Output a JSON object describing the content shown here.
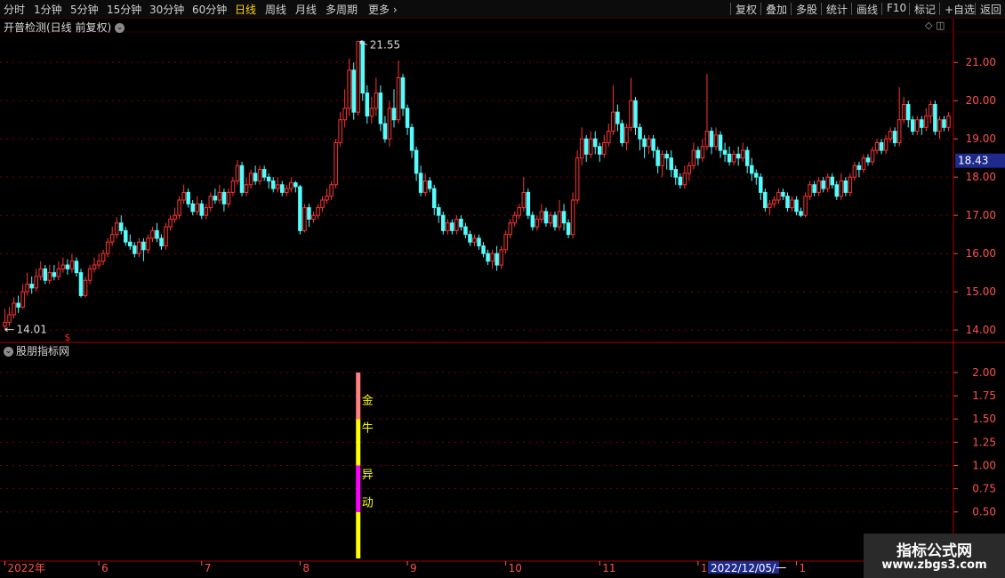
{
  "toolbar": {
    "periods": [
      "分时",
      "1分钟",
      "5分钟",
      "15分钟",
      "30分钟",
      "60分钟",
      "日线",
      "周线",
      "月线",
      "多周期",
      "更多"
    ],
    "active_period": "日线",
    "more_arrow": "›",
    "right": [
      "复权",
      "叠加",
      "多股",
      "统计",
      "画线",
      "F10",
      "标记",
      "+自选",
      "返回"
    ]
  },
  "main_panel": {
    "title": "开普检测(日线 前复权)",
    "high_label": "21.55",
    "low_label": "14.01",
    "current_price": "18.43",
    "marker_symbol": "$"
  },
  "indicator_panel": {
    "title": "股朋指标网",
    "signal_labels": [
      "金",
      "牛",
      "异",
      "动"
    ]
  },
  "time_axis": {
    "labels": [
      "2022年",
      "6",
      "7",
      "8",
      "9",
      "10",
      "11",
      "12",
      "1"
    ],
    "cursor_label": "2022/12/05/一"
  },
  "watermark": {
    "line1": "指标公式网",
    "line2": "www.zbgs3.com"
  },
  "colors": {
    "up": "#ff3333",
    "down": "#54fcfc",
    "grid": "#7a0000",
    "axis_text": "#ff5050",
    "signal_gold": "#ff8080",
    "signal_yellow": "#ffff00",
    "signal_magenta": "#ff00ff"
  },
  "chart_data": [
    {
      "type": "candlestick",
      "ylim": [
        13.7,
        21.75
      ],
      "yticks": [
        14.0,
        15.0,
        16.0,
        17.0,
        18.0,
        19.0,
        20.0,
        21.0
      ],
      "candles": [
        [
          14.1,
          14.2,
          14.55,
          14.01
        ],
        [
          14.2,
          14.4,
          14.6,
          14.1
        ],
        [
          14.4,
          14.7,
          14.85,
          14.3
        ],
        [
          14.7,
          14.6,
          14.9,
          14.45
        ],
        [
          14.6,
          15.0,
          15.2,
          14.55
        ],
        [
          15.0,
          15.2,
          15.5,
          14.9
        ],
        [
          15.2,
          15.1,
          15.4,
          14.95
        ],
        [
          15.1,
          15.4,
          15.6,
          15.0
        ],
        [
          15.4,
          15.6,
          15.8,
          15.3
        ],
        [
          15.6,
          15.3,
          15.7,
          15.2
        ],
        [
          15.3,
          15.5,
          15.7,
          15.2
        ],
        [
          15.5,
          15.4,
          15.7,
          15.3
        ],
        [
          15.4,
          15.6,
          15.8,
          15.3
        ],
        [
          15.6,
          15.7,
          15.9,
          15.5
        ],
        [
          15.7,
          15.6,
          15.85,
          15.45
        ],
        [
          15.6,
          15.8,
          16.0,
          15.5
        ],
        [
          15.8,
          15.5,
          15.9,
          15.4
        ],
        [
          15.5,
          14.9,
          15.6,
          14.85
        ],
        [
          14.9,
          15.3,
          15.4,
          14.85
        ],
        [
          15.3,
          15.6,
          15.7,
          15.2
        ],
        [
          15.6,
          15.7,
          15.9,
          15.5
        ],
        [
          15.7,
          15.8,
          16.0,
          15.6
        ],
        [
          15.8,
          16.0,
          16.1,
          15.7
        ],
        [
          16.0,
          16.3,
          16.4,
          15.9
        ],
        [
          16.3,
          16.5,
          16.7,
          16.2
        ],
        [
          16.5,
          16.8,
          16.95,
          16.4
        ],
        [
          16.8,
          16.6,
          17.0,
          16.5
        ],
        [
          16.6,
          16.3,
          16.7,
          16.2
        ],
        [
          16.3,
          16.2,
          16.5,
          16.1
        ],
        [
          16.2,
          16.0,
          16.3,
          15.9
        ],
        [
          16.0,
          16.3,
          16.4,
          15.9
        ],
        [
          16.3,
          16.1,
          16.4,
          15.8
        ],
        [
          16.1,
          16.4,
          16.5,
          16.0
        ],
        [
          16.4,
          16.6,
          16.7,
          16.3
        ],
        [
          16.6,
          16.4,
          16.8,
          16.3
        ],
        [
          16.4,
          16.2,
          16.5,
          16.1
        ],
        [
          16.2,
          16.7,
          16.8,
          16.1
        ],
        [
          16.7,
          16.9,
          17.0,
          16.6
        ],
        [
          16.9,
          17.0,
          17.2,
          16.8
        ],
        [
          17.0,
          17.4,
          17.5,
          16.9
        ],
        [
          17.4,
          17.6,
          17.8,
          17.3
        ],
        [
          17.6,
          17.3,
          17.7,
          17.2
        ],
        [
          17.3,
          17.1,
          17.4,
          17.0
        ],
        [
          17.1,
          17.3,
          17.5,
          17.0
        ],
        [
          17.3,
          17.0,
          17.4,
          16.9
        ],
        [
          17.0,
          17.2,
          17.3,
          16.9
        ],
        [
          17.2,
          17.5,
          17.6,
          17.1
        ],
        [
          17.5,
          17.4,
          17.7,
          17.3
        ],
        [
          17.4,
          17.6,
          17.8,
          17.3
        ],
        [
          17.6,
          17.3,
          17.7,
          17.1
        ],
        [
          17.3,
          17.6,
          17.7,
          17.2
        ],
        [
          17.6,
          17.9,
          18.0,
          17.5
        ],
        [
          17.9,
          18.3,
          18.45,
          17.8
        ],
        [
          18.3,
          17.6,
          18.4,
          17.5
        ],
        [
          17.6,
          17.8,
          18.0,
          17.5
        ],
        [
          17.8,
          18.1,
          18.2,
          17.7
        ],
        [
          18.1,
          17.9,
          18.3,
          17.8
        ],
        [
          17.9,
          18.2,
          18.3,
          17.8
        ],
        [
          18.2,
          18.0,
          18.3,
          17.9
        ],
        [
          18.0,
          17.9,
          18.1,
          17.7
        ],
        [
          17.9,
          17.7,
          18.0,
          17.6
        ],
        [
          17.7,
          17.8,
          18.0,
          17.6
        ],
        [
          17.8,
          17.6,
          17.9,
          17.5
        ],
        [
          17.6,
          17.7,
          17.8,
          17.5
        ],
        [
          17.7,
          17.85,
          18.0,
          17.6
        ],
        [
          17.85,
          17.75,
          17.9,
          17.6
        ],
        [
          17.75,
          16.6,
          17.8,
          16.5
        ],
        [
          16.6,
          17.2,
          17.3,
          16.55
        ],
        [
          17.2,
          16.9,
          17.3,
          16.7
        ],
        [
          16.9,
          17.0,
          17.1,
          16.8
        ],
        [
          17.0,
          17.2,
          17.3,
          16.9
        ],
        [
          17.2,
          17.4,
          17.5,
          17.1
        ],
        [
          17.4,
          17.5,
          17.7,
          17.3
        ],
        [
          17.5,
          17.8,
          17.9,
          17.4
        ],
        [
          17.8,
          18.9,
          19.0,
          17.7
        ],
        [
          18.9,
          19.5,
          19.7,
          18.8
        ],
        [
          19.5,
          19.8,
          20.3,
          19.3
        ],
        [
          19.8,
          20.8,
          21.1,
          19.6
        ],
        [
          20.8,
          19.7,
          21.0,
          19.5
        ],
        [
          19.7,
          21.55,
          21.55,
          19.6
        ],
        [
          21.55,
          20.2,
          21.4,
          20.0
        ],
        [
          20.2,
          19.6,
          20.4,
          19.4
        ],
        [
          19.6,
          19.8,
          20.1,
          19.4
        ],
        [
          19.8,
          20.2,
          20.6,
          19.6
        ],
        [
          20.2,
          19.4,
          20.4,
          19.2
        ],
        [
          19.4,
          19.0,
          19.6,
          18.9
        ],
        [
          19.0,
          19.8,
          20.0,
          18.8
        ],
        [
          19.8,
          19.5,
          20.3,
          19.3
        ],
        [
          19.5,
          20.6,
          21.05,
          19.4
        ],
        [
          20.6,
          19.8,
          20.7,
          19.6
        ],
        [
          19.8,
          19.3,
          19.9,
          19.1
        ],
        [
          19.3,
          18.7,
          19.4,
          18.5
        ],
        [
          18.7,
          18.1,
          18.8,
          17.9
        ],
        [
          18.1,
          17.6,
          18.3,
          17.5
        ],
        [
          17.6,
          17.9,
          18.1,
          17.5
        ],
        [
          17.9,
          17.7,
          18.0,
          17.6
        ],
        [
          17.7,
          17.2,
          17.8,
          17.0
        ],
        [
          17.2,
          17.0,
          17.3,
          16.8
        ],
        [
          17.0,
          16.6,
          17.1,
          16.5
        ],
        [
          16.6,
          16.8,
          16.9,
          16.5
        ],
        [
          16.8,
          16.6,
          16.9,
          16.5
        ],
        [
          16.6,
          16.9,
          17.0,
          16.5
        ],
        [
          16.9,
          16.7,
          17.0,
          16.6
        ],
        [
          16.7,
          16.5,
          16.8,
          16.4
        ],
        [
          16.5,
          16.3,
          16.6,
          16.2
        ],
        [
          16.3,
          16.4,
          16.5,
          16.2
        ],
        [
          16.4,
          16.2,
          16.5,
          16.1
        ],
        [
          16.2,
          16.0,
          16.3,
          15.9
        ],
        [
          16.0,
          15.8,
          16.1,
          15.7
        ],
        [
          15.8,
          16.0,
          16.1,
          15.6
        ],
        [
          16.0,
          15.7,
          16.2,
          15.55
        ],
        [
          15.7,
          16.1,
          16.2,
          15.6
        ],
        [
          16.1,
          16.5,
          16.6,
          16.0
        ],
        [
          16.5,
          16.8,
          16.9,
          16.4
        ],
        [
          16.8,
          17.0,
          17.1,
          16.7
        ],
        [
          17.0,
          17.2,
          17.3,
          16.9
        ],
        [
          17.2,
          17.6,
          18.0,
          17.1
        ],
        [
          17.6,
          17.0,
          17.7,
          16.9
        ],
        [
          17.0,
          16.7,
          17.1,
          16.6
        ],
        [
          16.7,
          16.9,
          17.0,
          16.6
        ],
        [
          16.9,
          17.1,
          17.3,
          16.8
        ],
        [
          17.1,
          16.8,
          17.2,
          16.7
        ],
        [
          16.8,
          17.0,
          17.1,
          16.7
        ],
        [
          17.0,
          16.7,
          17.1,
          16.6
        ],
        [
          16.7,
          17.1,
          17.4,
          16.6
        ],
        [
          17.1,
          16.8,
          17.3,
          16.6
        ],
        [
          16.8,
          16.5,
          16.9,
          16.4
        ],
        [
          16.5,
          17.4,
          17.6,
          16.4
        ],
        [
          17.4,
          18.5,
          18.7,
          17.3
        ],
        [
          18.5,
          19.0,
          19.3,
          18.3
        ],
        [
          19.0,
          18.6,
          19.1,
          18.4
        ],
        [
          18.6,
          19.0,
          19.2,
          18.5
        ],
        [
          19.0,
          18.8,
          19.2,
          18.6
        ],
        [
          18.8,
          18.6,
          18.9,
          18.4
        ],
        [
          18.6,
          18.9,
          19.1,
          18.5
        ],
        [
          18.9,
          19.2,
          19.4,
          18.8
        ],
        [
          19.2,
          19.7,
          20.4,
          19.1
        ],
        [
          19.7,
          19.4,
          19.9,
          19.2
        ],
        [
          19.4,
          18.9,
          19.5,
          18.8
        ],
        [
          18.9,
          19.3,
          19.4,
          18.7
        ],
        [
          19.3,
          20.0,
          20.6,
          19.2
        ],
        [
          20.0,
          19.3,
          20.1,
          19.1
        ],
        [
          19.3,
          19.0,
          19.4,
          18.7
        ],
        [
          19.0,
          18.8,
          19.1,
          18.5
        ],
        [
          18.8,
          19.0,
          19.1,
          18.6
        ],
        [
          19.0,
          18.7,
          19.1,
          18.5
        ],
        [
          18.7,
          18.3,
          18.8,
          18.1
        ],
        [
          18.3,
          18.6,
          18.7,
          18.0
        ],
        [
          18.6,
          18.5,
          18.7,
          18.2
        ],
        [
          18.5,
          18.2,
          18.7,
          18.0
        ],
        [
          18.2,
          18.0,
          18.3,
          17.8
        ],
        [
          18.0,
          17.8,
          18.1,
          17.7
        ],
        [
          17.8,
          18.1,
          18.3,
          17.7
        ],
        [
          18.1,
          18.3,
          18.4,
          17.9
        ],
        [
          18.3,
          18.7,
          18.9,
          18.2
        ],
        [
          18.7,
          18.5,
          18.8,
          18.3
        ],
        [
          18.5,
          18.8,
          19.0,
          18.4
        ],
        [
          18.8,
          19.2,
          20.7,
          18.7
        ],
        [
          19.2,
          18.8,
          19.3,
          18.6
        ],
        [
          18.8,
          19.1,
          19.3,
          18.7
        ],
        [
          19.1,
          18.7,
          19.2,
          18.5
        ],
        [
          18.7,
          18.6,
          18.9,
          18.4
        ],
        [
          18.6,
          18.4,
          18.8,
          18.3
        ],
        [
          18.4,
          18.6,
          18.7,
          18.3
        ],
        [
          18.6,
          18.5,
          18.8,
          18.3
        ],
        [
          18.5,
          18.7,
          18.9,
          18.4
        ],
        [
          18.7,
          18.3,
          18.8,
          18.1
        ],
        [
          18.3,
          18.1,
          18.5,
          17.9
        ],
        [
          18.1,
          18.0,
          18.2,
          17.8
        ],
        [
          18.0,
          17.6,
          18.1,
          17.4
        ],
        [
          17.6,
          17.2,
          17.7,
          17.1
        ],
        [
          17.2,
          17.3,
          17.4,
          17.0
        ],
        [
          17.3,
          17.4,
          17.5,
          17.2
        ],
        [
          17.4,
          17.6,
          17.7,
          17.3
        ],
        [
          17.6,
          17.5,
          17.7,
          17.4
        ],
        [
          17.5,
          17.2,
          17.6,
          17.1
        ],
        [
          17.2,
          17.4,
          17.5,
          17.1
        ],
        [
          17.4,
          17.1,
          17.5,
          17.0
        ],
        [
          17.1,
          17.0,
          17.2,
          16.95
        ],
        [
          17.0,
          17.5,
          17.6,
          16.95
        ],
        [
          17.5,
          17.8,
          17.9,
          17.4
        ],
        [
          17.8,
          17.6,
          17.9,
          17.5
        ],
        [
          17.6,
          17.9,
          18.0,
          17.5
        ],
        [
          17.9,
          17.7,
          18.0,
          17.6
        ],
        [
          17.7,
          18.0,
          18.1,
          17.6
        ],
        [
          18.0,
          17.8,
          18.1,
          17.7
        ],
        [
          17.8,
          17.5,
          17.9,
          17.4
        ],
        [
          17.5,
          17.9,
          18.1,
          17.4
        ],
        [
          17.9,
          17.6,
          18.0,
          17.5
        ],
        [
          17.6,
          18.0,
          18.1,
          17.5
        ],
        [
          18.0,
          18.3,
          18.4,
          17.9
        ],
        [
          18.3,
          18.2,
          18.4,
          18.0
        ],
        [
          18.2,
          18.5,
          18.6,
          18.1
        ],
        [
          18.5,
          18.4,
          18.6,
          18.3
        ],
        [
          18.4,
          18.7,
          18.8,
          18.3
        ],
        [
          18.7,
          18.9,
          19.0,
          18.6
        ],
        [
          18.9,
          18.7,
          19.0,
          18.6
        ],
        [
          18.7,
          19.0,
          19.1,
          18.6
        ],
        [
          19.0,
          19.2,
          19.3,
          18.9
        ],
        [
          19.2,
          18.9,
          19.3,
          18.8
        ],
        [
          18.9,
          19.5,
          20.35,
          18.8
        ],
        [
          19.5,
          19.9,
          20.1,
          19.4
        ],
        [
          19.9,
          19.5,
          20.0,
          19.3
        ],
        [
          19.5,
          19.2,
          19.6,
          19.1
        ],
        [
          19.2,
          19.5,
          19.6,
          19.1
        ],
        [
          19.5,
          19.3,
          19.6,
          19.1
        ],
        [
          19.3,
          19.6,
          19.8,
          19.2
        ],
        [
          19.6,
          19.9,
          20.0,
          19.4
        ],
        [
          19.9,
          19.2,
          20.0,
          19.1
        ],
        [
          19.2,
          19.5,
          19.6,
          19.0
        ],
        [
          19.5,
          19.3,
          19.6,
          19.2
        ],
        [
          19.3,
          19.6,
          19.7,
          19.2
        ]
      ]
    },
    {
      "type": "bar",
      "ylim": [
        0,
        2.2
      ],
      "yticks": [
        0.5,
        0.75,
        1.0,
        1.25,
        1.5,
        1.75,
        2.0
      ],
      "segments": [
        {
          "from": 0.0,
          "to": 0.5,
          "color": "#ffff00"
        },
        {
          "from": 0.5,
          "to": 1.0,
          "color": "#ff00ff"
        },
        {
          "from": 1.0,
          "to": 1.5,
          "color": "#ffff00"
        },
        {
          "from": 1.5,
          "to": 2.0,
          "color": "#ff8080"
        }
      ]
    }
  ]
}
